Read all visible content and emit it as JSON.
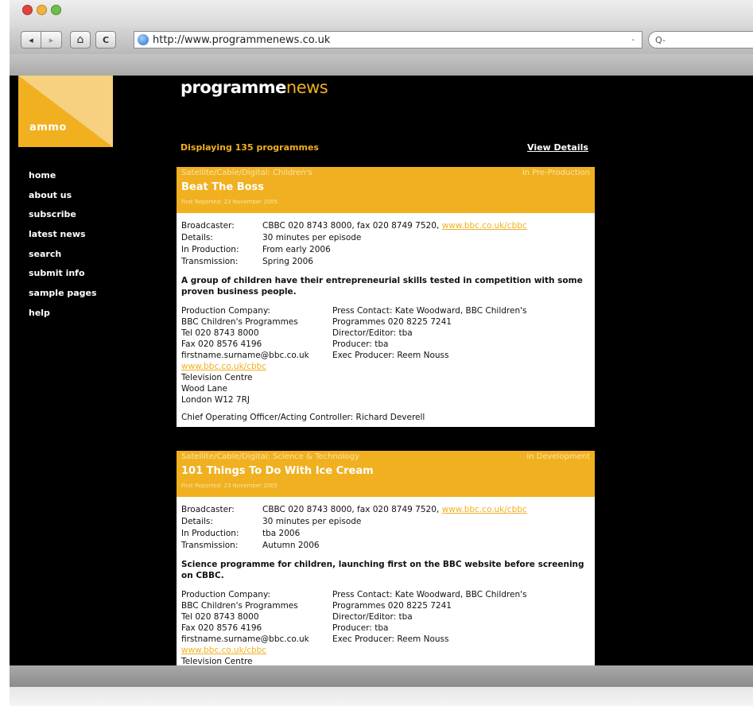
{
  "browser": {
    "url": "http://www.programmenews.co.uk",
    "search_placeholder": "Q-",
    "nav_back": "◂",
    "nav_forward": "▸",
    "home_icon": "⌂",
    "reload_icon": "C",
    "snapback_icon": "- "
  },
  "site": {
    "logo_text": "ammo",
    "title_bold": "programme",
    "title_light": "news",
    "displaying_text": "Displaying 135 programmes",
    "view_details": "View Details"
  },
  "menu": [
    "home",
    "about us",
    "subscribe",
    "latest news",
    "search",
    "submit info",
    "sample pages",
    "help"
  ],
  "programmes": [
    {
      "category": "Satellite/Cable/Digital: Children's",
      "status": "In Pre-Production",
      "title": "Beat The Boss",
      "first_reported": "First Reported: 23 November 2005",
      "broadcaster_label": "Broadcaster:",
      "broadcaster": "CBBC 020 8743 8000, fax 020 8749 7520,",
      "broadcaster_link": "www.bbc.co.uk/cbbc",
      "details_label": "Details:",
      "details": "30 minutes per episode",
      "production_label": "In Production:",
      "production": "From early 2006",
      "transmission_label": "Transmission:",
      "transmission": "Spring 2006",
      "description": "A group of children have their entrepreneurial skills tested in competition with some proven business people.",
      "company_lines": [
        "Production Company:",
        "BBC Children's Programmes",
        "Tel 020 8743 8000",
        "Fax 020 8576 4196",
        "firstname.surname@bbc.co.uk"
      ],
      "company_link": "www.bbc.co.uk/cbbc",
      "address_lines": [
        "Television Centre",
        "Wood Lane",
        "London W12 7RJ"
      ],
      "contact_lines": [
        "Press Contact: Kate Woodward, BBC Children's",
        "Programmes 020 8225 7241",
        "Director/Editor: tba",
        "Producer: tba",
        "Exec Producer: Reem Nouss"
      ],
      "coo": "Chief Operating Officer/Acting Controller: Richard Deverell"
    },
    {
      "category": "Satellite/Cable/Digital: Science & Technology",
      "status": "In Development",
      "title": "101 Things To Do With Ice Cream",
      "first_reported": "First Reported: 23 November 2005",
      "broadcaster_label": "Broadcaster:",
      "broadcaster": "CBBC 020 8743 8000, fax 020 8749 7520,",
      "broadcaster_link": "www.bbc.co.uk/cbbc",
      "details_label": "Details:",
      "details": "30 minutes per episode",
      "production_label": "In Production:",
      "production": "tba 2006",
      "transmission_label": "Transmission:",
      "transmission": "Autumn 2006",
      "description": "Science programme for children, launching first on the BBC website before screening on CBBC.",
      "company_lines": [
        "Production Company:",
        "BBC Children's Programmes",
        "Tel 020 8743 8000",
        "Fax 020 8576 4196",
        "firstname.surname@bbc.co.uk"
      ],
      "company_link": "www.bbc.co.uk/cbbc",
      "address_lines": [
        "Television Centre"
      ],
      "contact_lines": [
        "Press Contact: Kate Woodward, BBC Children's",
        "Programmes 020 8225 7241",
        "Director/Editor: tba",
        "Producer: tba",
        "Exec Producer: Reem Nouss"
      ]
    }
  ],
  "colors": {
    "accent": "#f0b020",
    "background": "#000000"
  }
}
